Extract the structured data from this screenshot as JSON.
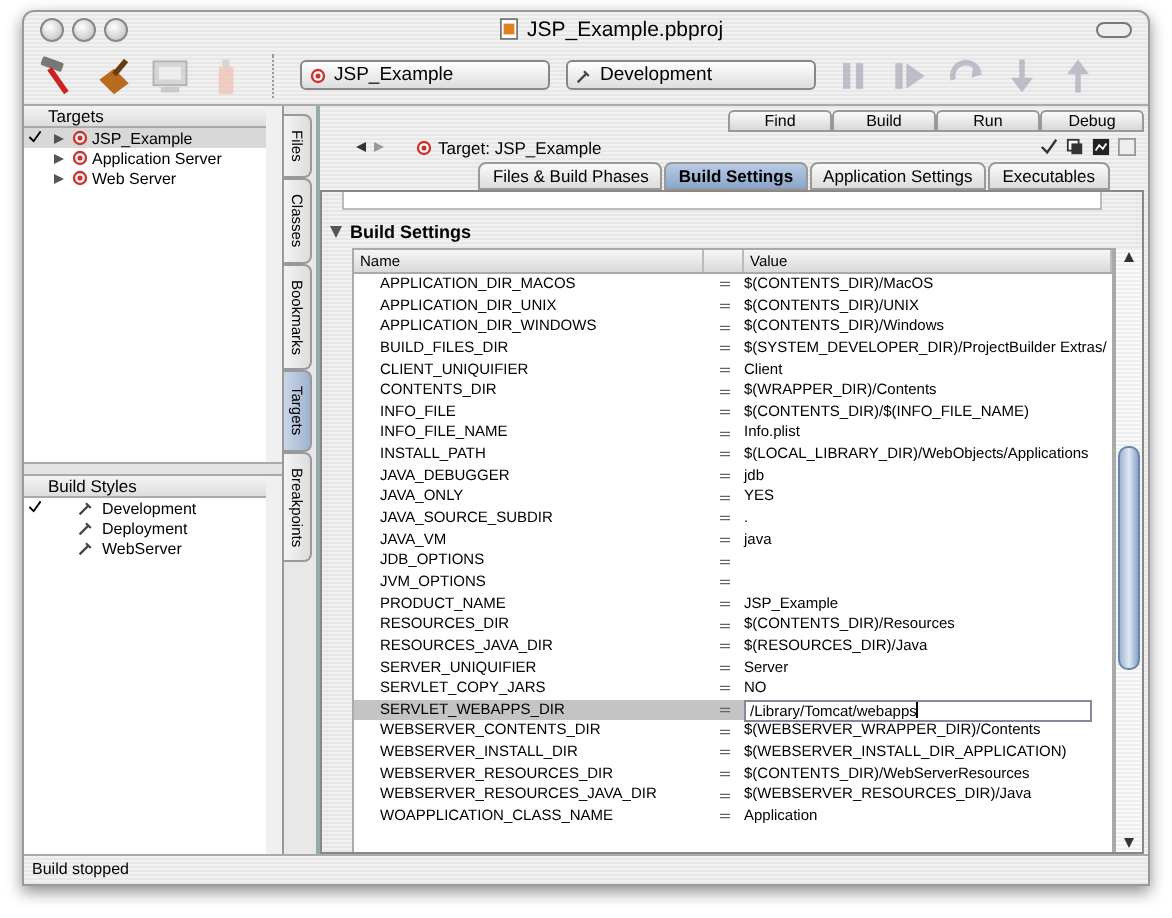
{
  "window": {
    "title": "JSP_Example.pbproj"
  },
  "toolbar": {
    "target_popup": "JSP_Example",
    "build_style_popup": "Development"
  },
  "targets": {
    "header": "Targets",
    "items": [
      {
        "label": "JSP_Example",
        "active": true,
        "selected": true
      },
      {
        "label": "Application Server",
        "active": false,
        "selected": false
      },
      {
        "label": "Web Server",
        "active": false,
        "selected": false
      }
    ]
  },
  "build_styles": {
    "header": "Build Styles",
    "items": [
      {
        "label": "Development",
        "active": true
      },
      {
        "label": "Deployment",
        "active": false
      },
      {
        "label": "WebServer",
        "active": false
      }
    ]
  },
  "side_tabs": [
    {
      "label": "Files",
      "selected": false
    },
    {
      "label": "Classes",
      "selected": false
    },
    {
      "label": "Bookmarks",
      "selected": false
    },
    {
      "label": "Targets",
      "selected": true
    },
    {
      "label": "Breakpoints",
      "selected": false
    }
  ],
  "action_buttons": [
    "Find",
    "Build",
    "Run",
    "Debug"
  ],
  "target_selector": "Target: JSP_Example",
  "tabs": [
    {
      "label": "Files & Build Phases",
      "selected": false
    },
    {
      "label": "Build Settings",
      "selected": true
    },
    {
      "label": "Application Settings",
      "selected": false
    },
    {
      "label": "Executables",
      "selected": false
    }
  ],
  "section": {
    "title": "Build Settings",
    "expanded": true
  },
  "table": {
    "columns": [
      "Name",
      "Value"
    ],
    "rows": [
      {
        "name": "APPLICATION_DIR_MACOS",
        "value": "$(CONTENTS_DIR)/MacOS",
        "selected": false
      },
      {
        "name": "APPLICATION_DIR_UNIX",
        "value": "$(CONTENTS_DIR)/UNIX",
        "selected": false
      },
      {
        "name": "APPLICATION_DIR_WINDOWS",
        "value": "$(CONTENTS_DIR)/Windows",
        "selected": false
      },
      {
        "name": "BUILD_FILES_DIR",
        "value": "$(SYSTEM_DEVELOPER_DIR)/ProjectBuilder Extras/",
        "selected": false
      },
      {
        "name": "CLIENT_UNIQUIFIER",
        "value": "Client",
        "selected": false
      },
      {
        "name": "CONTENTS_DIR",
        "value": "$(WRAPPER_DIR)/Contents",
        "selected": false
      },
      {
        "name": "INFO_FILE",
        "value": "$(CONTENTS_DIR)/$(INFO_FILE_NAME)",
        "selected": false
      },
      {
        "name": "INFO_FILE_NAME",
        "value": "Info.plist",
        "selected": false
      },
      {
        "name": "INSTALL_PATH",
        "value": "$(LOCAL_LIBRARY_DIR)/WebObjects/Applications",
        "selected": false
      },
      {
        "name": "JAVA_DEBUGGER",
        "value": "jdb",
        "selected": false
      },
      {
        "name": "JAVA_ONLY",
        "value": "YES",
        "selected": false
      },
      {
        "name": "JAVA_SOURCE_SUBDIR",
        "value": ".",
        "selected": false
      },
      {
        "name": "JAVA_VM",
        "value": "java",
        "selected": false
      },
      {
        "name": "JDB_OPTIONS",
        "selected": false
      },
      {
        "name": "JVM_OPTIONS",
        "selected": false
      },
      {
        "name": "PRODUCT_NAME",
        "value": "JSP_Example",
        "selected": false
      },
      {
        "name": "RESOURCES_DIR",
        "value": "$(CONTENTS_DIR)/Resources",
        "selected": false
      },
      {
        "name": "RESOURCES_JAVA_DIR",
        "value": "$(RESOURCES_DIR)/Java",
        "selected": false
      },
      {
        "name": "SERVER_UNIQUIFIER",
        "value": "Server",
        "selected": false
      },
      {
        "name": "SERVLET_COPY_JARS",
        "value": "NO",
        "selected": false
      },
      {
        "name": "SERVLET_WEBAPPS_DIR",
        "value": "/Library/Tomcat/webapps",
        "selected": true
      },
      {
        "name": "WEBSERVER_CONTENTS_DIR",
        "value": "$(WEBSERVER_WRAPPER_DIR)/Contents",
        "selected": false
      },
      {
        "name": "WEBSERVER_INSTALL_DIR",
        "value": "$(WEBSERVER_INSTALL_DIR_APPLICATION)",
        "selected": false
      },
      {
        "name": "WEBSERVER_RESOURCES_DIR",
        "value": "$(CONTENTS_DIR)/WebServerResources",
        "selected": false
      },
      {
        "name": "WEBSERVER_RESOURCES_JAVA_DIR",
        "value": "$(WEBSERVER_RESOURCES_DIR)/Java",
        "selected": false
      },
      {
        "name": "WOAPPLICATION_CLASS_NAME",
        "value": "Application",
        "selected": false
      }
    ]
  },
  "status_bar": "Build stopped"
}
